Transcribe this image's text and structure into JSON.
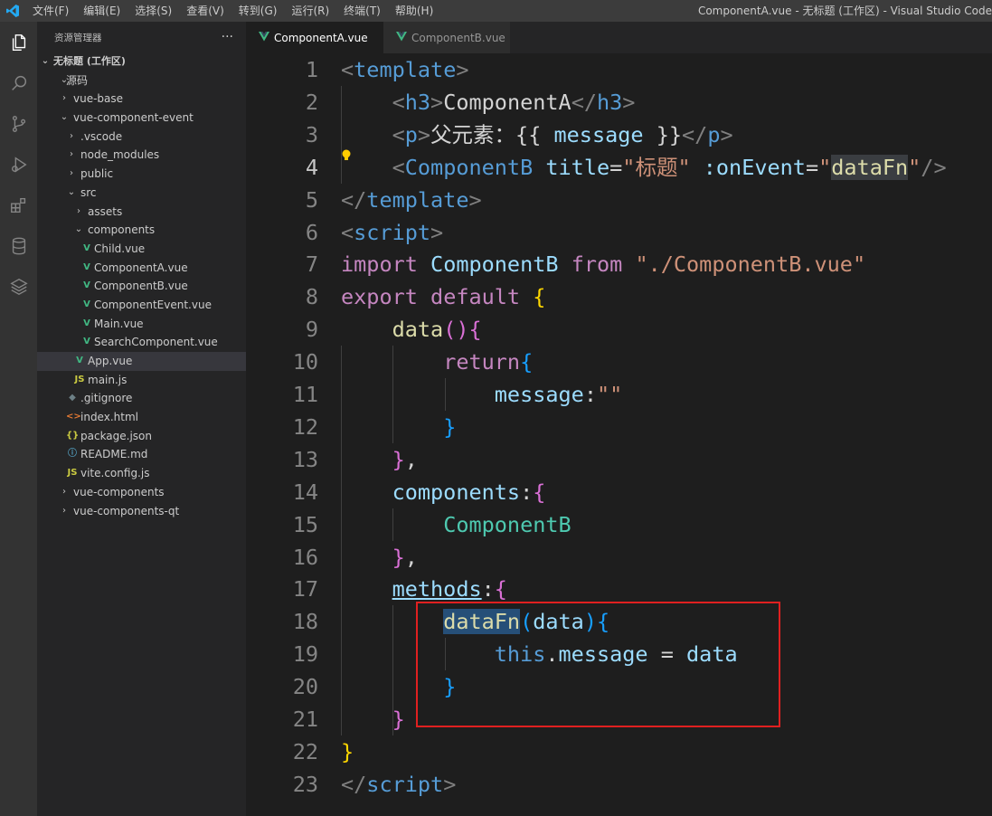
{
  "window": {
    "title": "ComponentA.vue - 无标题 (工作区) - Visual Studio Code",
    "menu": [
      "文件(F)",
      "编辑(E)",
      "选择(S)",
      "查看(V)",
      "转到(G)",
      "运行(R)",
      "终端(T)",
      "帮助(H)"
    ]
  },
  "activity": {
    "icons": [
      "explorer-icon",
      "search-icon",
      "source-control-icon",
      "run-debug-icon",
      "extensions-icon",
      "database-icon",
      "layers-icon"
    ]
  },
  "explorer": {
    "title": "资源管理器",
    "more": "···",
    "workspace": "无标题 (工作区)",
    "tree": [
      {
        "label": "源码",
        "chev": "⌄",
        "icon": "",
        "kind": "folder"
      },
      {
        "label": "vue-base",
        "chev": "›",
        "icon": "",
        "kind": "folder"
      },
      {
        "label": "vue-component-event",
        "chev": "⌄",
        "icon": "",
        "kind": "folder"
      },
      {
        "label": ".vscode",
        "chev": "›",
        "icon": "",
        "kind": "folder"
      },
      {
        "label": "node_modules",
        "chev": "›",
        "icon": "",
        "kind": "folder"
      },
      {
        "label": "public",
        "chev": "›",
        "icon": "",
        "kind": "folder"
      },
      {
        "label": "src",
        "chev": "⌄",
        "icon": "",
        "kind": "folder"
      },
      {
        "label": "assets",
        "chev": "›",
        "icon": "",
        "kind": "folder"
      },
      {
        "label": "components",
        "chev": "⌄",
        "icon": "",
        "kind": "folder"
      },
      {
        "label": "Child.vue",
        "chev": "",
        "icon": "V",
        "kind": "vue"
      },
      {
        "label": "ComponentA.vue",
        "chev": "",
        "icon": "V",
        "kind": "vue"
      },
      {
        "label": "ComponentB.vue",
        "chev": "",
        "icon": "V",
        "kind": "vue"
      },
      {
        "label": "ComponentEvent.vue",
        "chev": "",
        "icon": "V",
        "kind": "vue"
      },
      {
        "label": "Main.vue",
        "chev": "",
        "icon": "V",
        "kind": "vue"
      },
      {
        "label": "SearchComponent.vue",
        "chev": "",
        "icon": "V",
        "kind": "vue"
      },
      {
        "label": "App.vue",
        "chev": "",
        "icon": "V",
        "kind": "vue"
      },
      {
        "label": "main.js",
        "chev": "",
        "icon": "JS",
        "kind": "js"
      },
      {
        "label": ".gitignore",
        "chev": "",
        "icon": "◆",
        "kind": "git"
      },
      {
        "label": "index.html",
        "chev": "",
        "icon": "<>",
        "kind": "html"
      },
      {
        "label": "package.json",
        "chev": "",
        "icon": "{}",
        "kind": "json"
      },
      {
        "label": "README.md",
        "chev": "",
        "icon": "ⓘ",
        "kind": "md"
      },
      {
        "label": "vite.config.js",
        "chev": "",
        "icon": "JS",
        "kind": "js"
      },
      {
        "label": "vue-components",
        "chev": "›",
        "icon": "",
        "kind": "folder"
      },
      {
        "label": "vue-components-qt",
        "chev": "›",
        "icon": "",
        "kind": "folder"
      }
    ],
    "selected_index": 15
  },
  "tabs": [
    {
      "label": "ComponentA.vue",
      "active": true
    },
    {
      "label": "ComponentB.vue",
      "active": false
    }
  ],
  "editor": {
    "current_line": 4,
    "lines": [
      {
        "n": "1",
        "tokens": [
          [
            "<",
            "punc"
          ],
          [
            "template",
            "tag"
          ],
          [
            ">",
            "punc"
          ]
        ]
      },
      {
        "n": "2",
        "tokens": [
          [
            "    ",
            ""
          ],
          [
            "<",
            "punc"
          ],
          [
            "h3",
            "tag"
          ],
          [
            ">",
            "punc"
          ],
          [
            "ComponentA",
            "text"
          ],
          [
            "</",
            "punc"
          ],
          [
            "h3",
            "tag"
          ],
          [
            ">",
            "punc"
          ]
        ]
      },
      {
        "n": "3",
        "tokens": [
          [
            "    ",
            ""
          ],
          [
            "<",
            "punc"
          ],
          [
            "p",
            "tag"
          ],
          [
            ">",
            "punc"
          ],
          [
            "父元素：{{ ",
            "text"
          ],
          [
            "message",
            "attr"
          ],
          [
            " }}",
            "text"
          ],
          [
            "</",
            "punc"
          ],
          [
            "p",
            "tag"
          ],
          [
            ">",
            "punc"
          ]
        ]
      },
      {
        "n": "4",
        "tokens": [
          [
            "    ",
            ""
          ],
          [
            "<",
            "punc"
          ],
          [
            "ComponentB",
            "tag"
          ],
          [
            " ",
            ""
          ],
          [
            "title",
            "attr"
          ],
          [
            "=",
            "text"
          ],
          [
            "\"标题\"",
            "str"
          ],
          [
            " ",
            ""
          ],
          [
            ":onEvent",
            "attr"
          ],
          [
            "=",
            "text"
          ],
          [
            "\"",
            "str"
          ],
          [
            "dataFn",
            "fn hl2"
          ],
          [
            "\"",
            "str"
          ],
          [
            "/>",
            "punc"
          ]
        ]
      },
      {
        "n": "5",
        "tokens": [
          [
            "</",
            "punc"
          ],
          [
            "template",
            "tag"
          ],
          [
            ">",
            "punc"
          ]
        ]
      },
      {
        "n": "6",
        "tokens": [
          [
            "<",
            "punc"
          ],
          [
            "script",
            "tag"
          ],
          [
            ">",
            "punc"
          ]
        ]
      },
      {
        "n": "7",
        "tokens": [
          [
            "import",
            "kw"
          ],
          [
            " ",
            ""
          ],
          [
            "ComponentB",
            "attr"
          ],
          [
            " ",
            ""
          ],
          [
            "from",
            "kw"
          ],
          [
            " ",
            ""
          ],
          [
            "\"./ComponentB.vue\"",
            "str"
          ]
        ]
      },
      {
        "n": "8",
        "tokens": [
          [
            "export",
            "kw"
          ],
          [
            " ",
            ""
          ],
          [
            "default",
            "kw"
          ],
          [
            " ",
            ""
          ],
          [
            "{",
            "bk1"
          ]
        ]
      },
      {
        "n": "9",
        "tokens": [
          [
            "    ",
            ""
          ],
          [
            "data",
            "fn"
          ],
          [
            "()",
            "bk2"
          ],
          [
            "{",
            "bk2"
          ]
        ]
      },
      {
        "n": "10",
        "tokens": [
          [
            "        ",
            ""
          ],
          [
            "return",
            "kw"
          ],
          [
            "{",
            "bk3"
          ]
        ]
      },
      {
        "n": "11",
        "tokens": [
          [
            "            ",
            ""
          ],
          [
            "message",
            "attr"
          ],
          [
            ":",
            "text"
          ],
          [
            "\"\"",
            "str"
          ]
        ]
      },
      {
        "n": "12",
        "tokens": [
          [
            "        ",
            ""
          ],
          [
            "}",
            "bk3"
          ]
        ]
      },
      {
        "n": "13",
        "tokens": [
          [
            "    ",
            ""
          ],
          [
            "}",
            "bk2"
          ],
          [
            ",",
            "text"
          ]
        ]
      },
      {
        "n": "14",
        "tokens": [
          [
            "    ",
            ""
          ],
          [
            "components",
            "attr"
          ],
          [
            ":",
            "text"
          ],
          [
            "{",
            "bk2"
          ]
        ]
      },
      {
        "n": "15",
        "tokens": [
          [
            "        ",
            ""
          ],
          [
            "ComponentB",
            "comp"
          ]
        ]
      },
      {
        "n": "16",
        "tokens": [
          [
            "    ",
            ""
          ],
          [
            "}",
            "bk2"
          ],
          [
            ",",
            "text"
          ]
        ]
      },
      {
        "n": "17",
        "tokens": [
          [
            "    ",
            ""
          ],
          [
            "methods",
            "attr uline"
          ],
          [
            ":",
            "text"
          ],
          [
            "{",
            "bk2"
          ]
        ]
      },
      {
        "n": "18",
        "tokens": [
          [
            "        ",
            ""
          ],
          [
            "dataFn",
            "fn hl"
          ],
          [
            "(",
            "bk3"
          ],
          [
            "data",
            "attr"
          ],
          [
            ")",
            "bk3"
          ],
          [
            "{",
            "bk3"
          ]
        ]
      },
      {
        "n": "19",
        "tokens": [
          [
            "            ",
            ""
          ],
          [
            "this",
            "this"
          ],
          [
            ".",
            "text"
          ],
          [
            "message",
            "attr"
          ],
          [
            " = ",
            "text"
          ],
          [
            "data",
            "attr"
          ]
        ]
      },
      {
        "n": "20",
        "tokens": [
          [
            "        ",
            ""
          ],
          [
            "}",
            "bk3"
          ]
        ]
      },
      {
        "n": "21",
        "tokens": [
          [
            "    ",
            ""
          ],
          [
            "}",
            "bk2"
          ]
        ]
      },
      {
        "n": "22",
        "tokens": [
          [
            "}",
            "bk1"
          ]
        ]
      },
      {
        "n": "23",
        "tokens": [
          [
            "</",
            "punc"
          ],
          [
            "script",
            "tag"
          ],
          [
            ">",
            "punc"
          ]
        ]
      }
    ]
  },
  "colors": {
    "accent": "#0078d4",
    "vue_icon": "#41b883",
    "js_icon": "#cbcb41",
    "annotation_box": "#e02020",
    "lightbulb": "#ffcc00"
  }
}
